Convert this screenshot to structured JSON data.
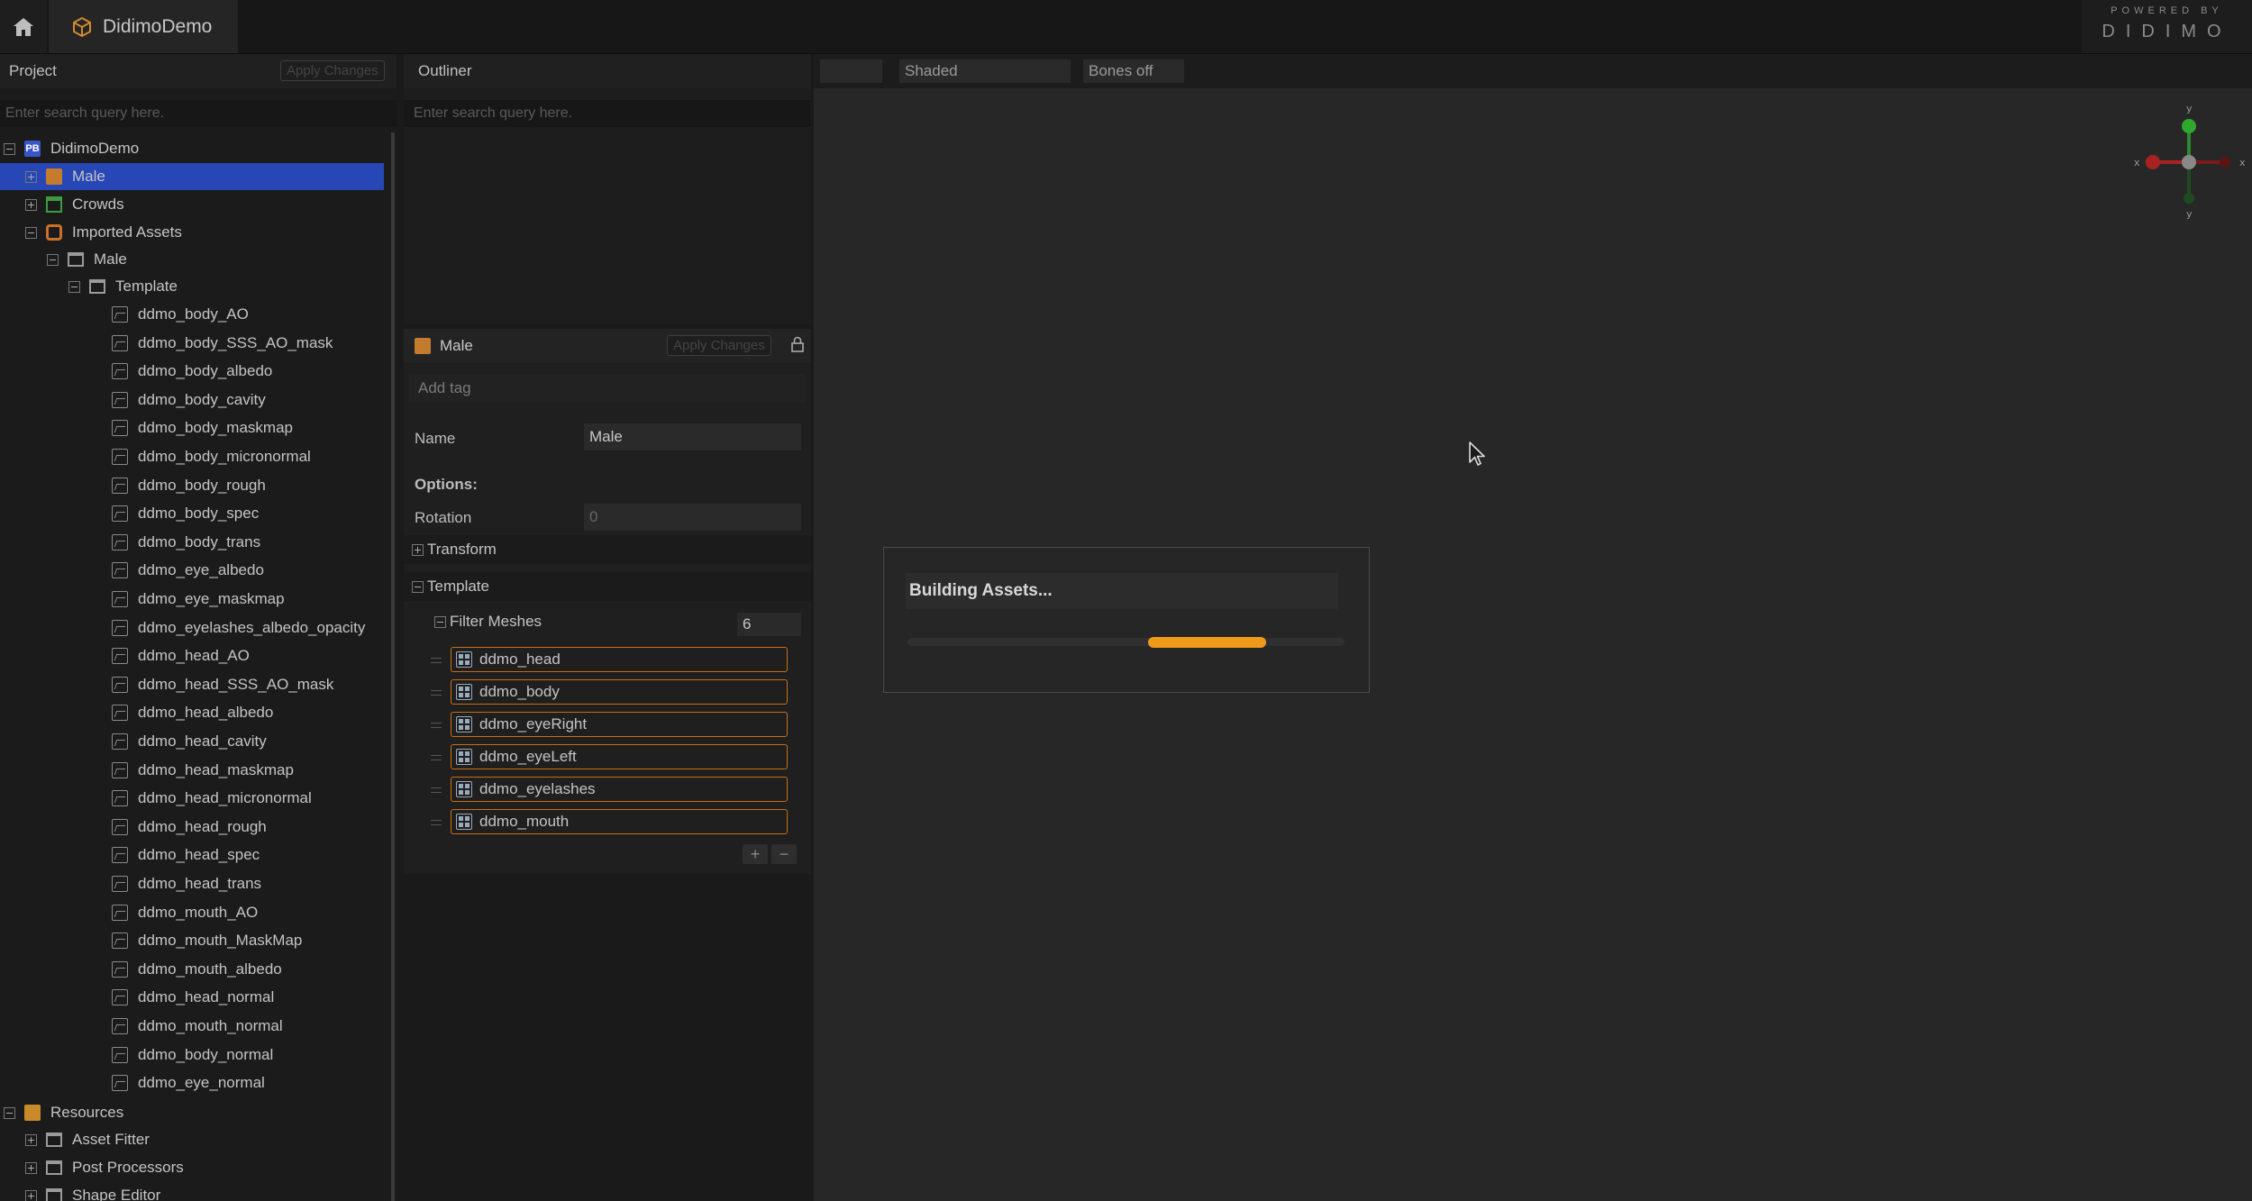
{
  "app": {
    "title": "DidimoDemo"
  },
  "branding": {
    "line1": "POWERED BY",
    "line2": "DIDIMO"
  },
  "project_panel": {
    "title": "Project",
    "apply_label": "Apply Changes",
    "search_placeholder": "Enter search query here.",
    "tree": {
      "root": "DidimoDemo",
      "male": "Male",
      "crowds": "Crowds",
      "imported_assets": "Imported Assets",
      "imported_male": "Male",
      "template": "Template",
      "textures": [
        "ddmo_body_AO",
        "ddmo_body_SSS_AO_mask",
        "ddmo_body_albedo",
        "ddmo_body_cavity",
        "ddmo_body_maskmap",
        "ddmo_body_micronormal",
        "ddmo_body_rough",
        "ddmo_body_spec",
        "ddmo_body_trans",
        "ddmo_eye_albedo",
        "ddmo_eye_maskmap",
        "ddmo_eyelashes_albedo_opacity",
        "ddmo_head_AO",
        "ddmo_head_SSS_AO_mask",
        "ddmo_head_albedo",
        "ddmo_head_cavity",
        "ddmo_head_maskmap",
        "ddmo_head_micronormal",
        "ddmo_head_rough",
        "ddmo_head_spec",
        "ddmo_head_trans",
        "ddmo_mouth_AO",
        "ddmo_mouth_MaskMap",
        "ddmo_mouth_albedo",
        "ddmo_head_normal",
        "ddmo_mouth_normal",
        "ddmo_body_normal",
        "ddmo_eye_normal"
      ],
      "resources": "Resources",
      "asset_fitter": "Asset Fitter",
      "post_processors": "Post Processors",
      "shape_editor": "Shape Editor"
    }
  },
  "outliner": {
    "title": "Outliner",
    "search_placeholder": "Enter search query here."
  },
  "inspector": {
    "title": "Male",
    "apply_label": "Apply Changes",
    "add_tag": "Add tag",
    "name_label": "Name",
    "name_value": "Male",
    "options_label": "Options:",
    "rotation_label": "Rotation",
    "rotation_value": "0",
    "transform_label": "Transform",
    "template_label": "Template",
    "filter_meshes_label": "Filter Meshes",
    "filter_meshes_count": "6",
    "meshes": [
      "ddmo_head",
      "ddmo_body",
      "ddmo_eyeRight",
      "ddmo_eyeLeft",
      "ddmo_eyelashes",
      "ddmo_mouth"
    ],
    "add_btn": "+",
    "remove_btn": "−"
  },
  "viewport": {
    "mode_blank": "",
    "shading": "Shaded",
    "bones": "Bones off",
    "gizmo_labels": {
      "x": "x",
      "y": "y"
    }
  },
  "dialog": {
    "title": "Building Assets...",
    "progress_start": 0.55,
    "progress_end": 0.82,
    "accent_color": "#f09a1a"
  },
  "colors": {
    "selection": "#2747b6",
    "mesh_border": "#c96f14"
  }
}
